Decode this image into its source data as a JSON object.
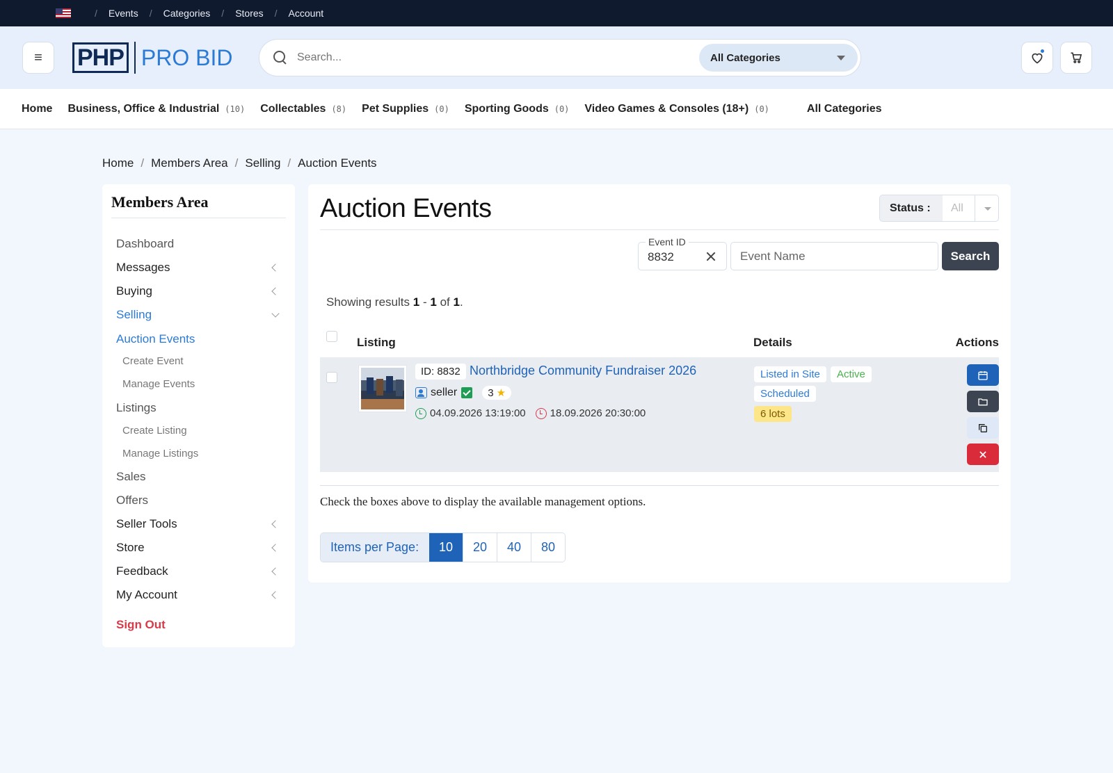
{
  "topbar": {
    "items": [
      "Events",
      "Categories",
      "Stores",
      "Account"
    ]
  },
  "header": {
    "logo_php": "PHP",
    "logo_probid": "PRO BID",
    "search_placeholder": "Search...",
    "category_select": "All Categories"
  },
  "catnav": {
    "home": "Home",
    "items": [
      {
        "label": "Business, Office & Industrial",
        "count": "(10)"
      },
      {
        "label": "Collectables",
        "count": "(8)"
      },
      {
        "label": "Pet Supplies",
        "count": "(0)"
      },
      {
        "label": "Sporting Goods",
        "count": "(0)"
      },
      {
        "label": "Video Games & Consoles (18+)",
        "count": "(0)"
      }
    ],
    "all": "All Categories"
  },
  "breadcrumb": [
    "Home",
    "Members Area",
    "Selling",
    "Auction Events"
  ],
  "sidebar": {
    "title": "Members Area",
    "items": {
      "dashboard": "Dashboard",
      "messages": "Messages",
      "buying": "Buying",
      "selling": "Selling",
      "auction_events": "Auction Events",
      "create_event": "Create Event",
      "manage_events": "Manage Events",
      "listings": "Listings",
      "create_listing": "Create Listing",
      "manage_listings": "Manage Listings",
      "sales": "Sales",
      "offers": "Offers",
      "seller_tools": "Seller Tools",
      "store": "Store",
      "feedback": "Feedback",
      "my_account": "My Account",
      "sign_out": "Sign Out"
    }
  },
  "main": {
    "title": "Auction Events",
    "status_label": "Status :",
    "status_value": "All",
    "filter": {
      "event_id_label": "Event ID",
      "event_id_value": "8832",
      "event_name_placeholder": "Event Name",
      "search_button": "Search"
    },
    "showing": {
      "prefix": "Showing results",
      "from": "1",
      "dash": "-",
      "to": "1",
      "of": "of",
      "total": "1"
    },
    "table": {
      "headers": {
        "listing": "Listing",
        "details": "Details",
        "actions": "Actions"
      },
      "rows": [
        {
          "id": "ID: 8832",
          "title": "Northbridge Community Fundraiser 2026",
          "seller": "seller",
          "rating": "3",
          "start": "04.09.2026 13:19:00",
          "end": "18.09.2026 20:30:00",
          "badges": {
            "listed": "Listed in Site",
            "active": "Active",
            "scheduled": "Scheduled",
            "lots": "6 lots"
          }
        }
      ]
    },
    "note": "Check the boxes above to display the available management options.",
    "pagination": {
      "label": "Items per Page:",
      "options": [
        "10",
        "20",
        "40",
        "80"
      ],
      "selected": "10"
    }
  },
  "colors": {
    "primary": "#1f63b8",
    "dark": "#3c4451",
    "danger": "#d92b3a",
    "topbar": "#0f1a2e"
  }
}
